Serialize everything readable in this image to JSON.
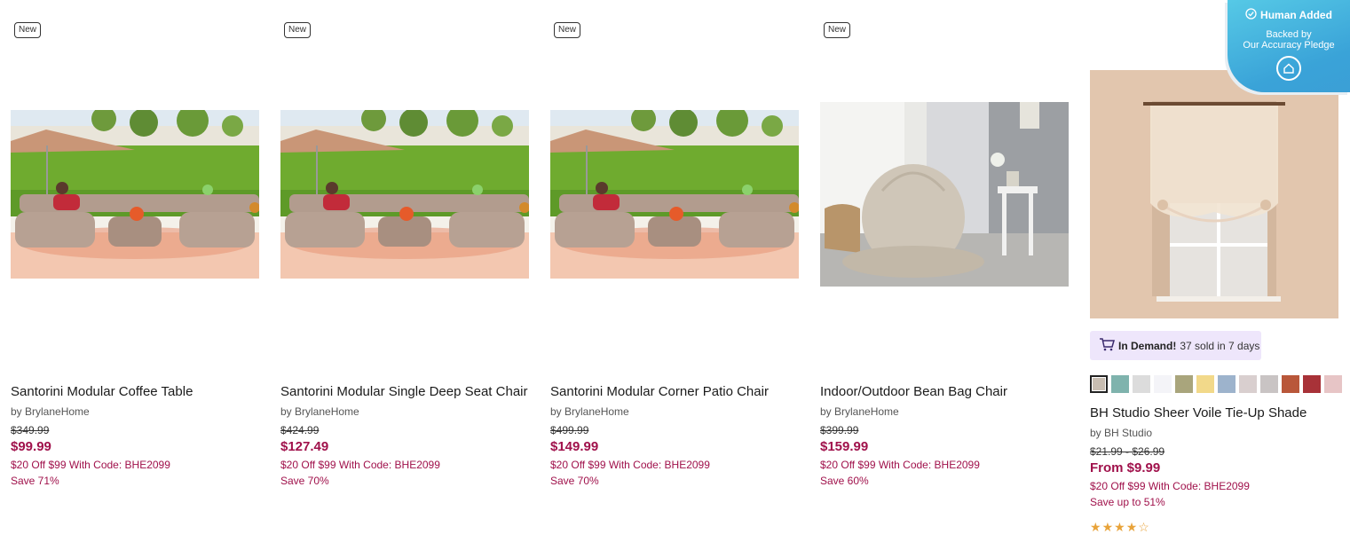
{
  "products": [
    {
      "badge": "New",
      "title": "Santorini Modular Coffee Table",
      "brand": "by BrylaneHome",
      "was_price": "$349.99",
      "price": "$99.99",
      "promo": "$20 Off $99 With Code: BHE2099",
      "save": "Save 71%"
    },
    {
      "badge": "New",
      "title": "Santorini Modular Single Deep Seat Chair",
      "brand": "by BrylaneHome",
      "was_price": "$424.99",
      "price": "$127.49",
      "promo": "$20 Off $99 With Code: BHE2099",
      "save": "Save 70%"
    },
    {
      "badge": "New",
      "title": "Santorini Modular Corner Patio Chair",
      "brand": "by BrylaneHome",
      "was_price": "$499.99",
      "price": "$149.99",
      "promo": "$20 Off $99 With Code: BHE2099",
      "save": "Save 70%"
    },
    {
      "badge": "New",
      "title": "Indoor/Outdoor Bean Bag Chair",
      "brand": "by BrylaneHome",
      "was_price": "$399.99",
      "price": "$159.99",
      "promo": "$20 Off $99 With Code: BHE2099",
      "save": "Save 60%"
    },
    {
      "title": "BH Studio Sheer Voile Tie-Up Shade",
      "brand": "by BH Studio",
      "was_price": "$21.99 - $26.99",
      "price": "From $9.99",
      "promo": "$20 Off $99 With Code: BHE2099",
      "save": "Save up to 51%",
      "demand_label": "In Demand!",
      "demand_text": "37 sold in 7 days",
      "rating": 4,
      "rating_max": 5,
      "swatches": [
        "#c8bdb1",
        "#7fb3ad",
        "#dcdcdc",
        "#f4f4f8",
        "#a9a57c",
        "#f2d98a",
        "#9db3cc",
        "#d9cfcf",
        "#c9c4c4",
        "#b9573a",
        "#a83238",
        "#e7c5c6"
      ]
    }
  ],
  "pledge": {
    "title": "Human Added",
    "line1": "Backed by",
    "line2": "Our Accuracy Pledge",
    "icon": "home-circle-icon"
  },
  "colors": {
    "accent": "#a0114b",
    "demand_bg": "#eee6fb",
    "star": "#e8a33a"
  }
}
